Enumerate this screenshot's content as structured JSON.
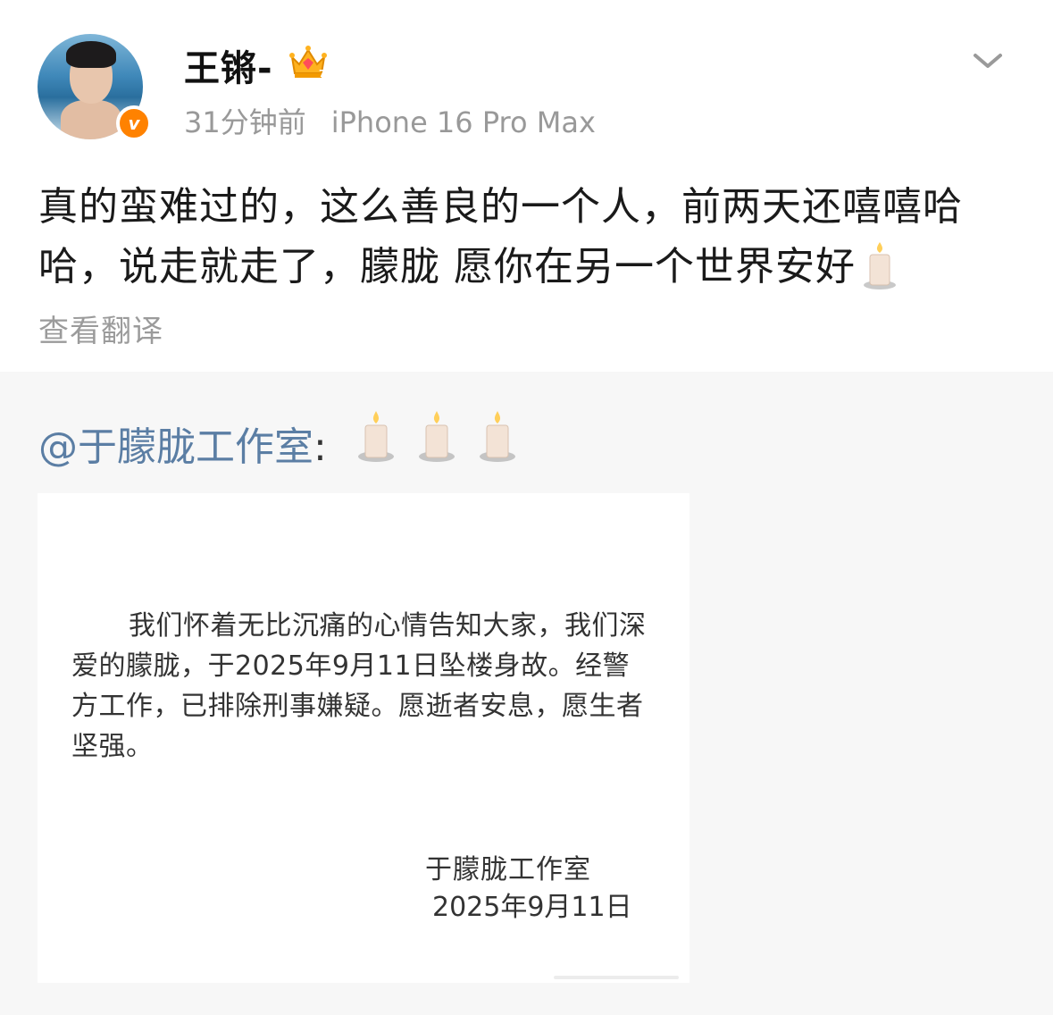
{
  "post": {
    "author": "王锵-",
    "time": "31分钟前",
    "device": "iPhone 16 Pro Max",
    "text": "真的蛮难过的，这么善良的一个人，前两天还嘻嘻哈哈，说走就走了，朦胧 愿你在另一个世界安好",
    "translate_label": "查看翻译",
    "badge_letter": "v",
    "icons": [
      "avatar",
      "verified-badge",
      "crown-icon",
      "chevron-down-icon",
      "candle-icon"
    ]
  },
  "repost": {
    "mention": "@于朦胧工作室",
    "colon": ":",
    "notice": {
      "body": "我们怀着无比沉痛的心情告知大家，我们深爱的朦胧，于2025年9月11日坠楼身故。经警方工作，已排除刑事嫌疑。愿逝者安息，愿生者坚强。",
      "signature_name": "于朦胧工作室",
      "signature_date": "2025年9月11日"
    }
  },
  "colors": {
    "link": "#5b7ea4",
    "meta": "#999999",
    "badge": "#ff8200",
    "repost_bg": "#f7f7f7"
  }
}
